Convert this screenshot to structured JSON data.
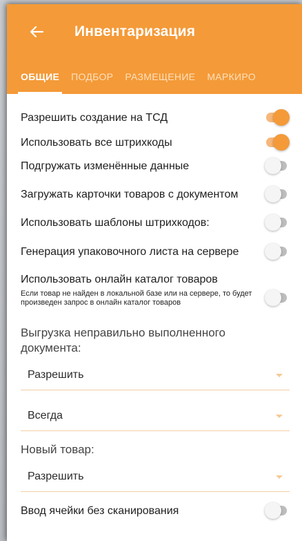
{
  "header": {
    "title": "Инвентаризация"
  },
  "tabs": [
    {
      "label": "ОБЩИЕ",
      "active": true
    },
    {
      "label": "ПОДБОР",
      "active": false
    },
    {
      "label": "РАЗМЕЩЕНИЕ",
      "active": false
    },
    {
      "label": "МАРКИРО",
      "active": false
    }
  ],
  "settings": [
    {
      "label": "Разрешить создание на ТСД",
      "enabled": true
    },
    {
      "label": "Использовать все штрихкоды",
      "enabled": true
    },
    {
      "label": "Подгружать изменённые данные",
      "enabled": false
    },
    {
      "label": "Загружать карточки товаров с документом",
      "enabled": false
    },
    {
      "label": "Использовать шаблоны штрихкодов:",
      "enabled": false
    },
    {
      "label": "Генерация упаковочного листа на сервере",
      "enabled": false
    },
    {
      "label": "Использовать онлайн каталог товаров",
      "note": "Если товар не найден в локальной базе или на сервере, то будет произведен запрос в онлайн каталог товаров",
      "enabled": false
    }
  ],
  "unload_section": {
    "label": "Выгрузка неправильно выполненного документа:",
    "select1": "Разрешить",
    "select2": "Всегда"
  },
  "new_item_section": {
    "label": "Новый товар:",
    "select": "Разрешить"
  },
  "last_setting": {
    "label": "Ввод ячейки без сканирования",
    "enabled": false
  },
  "colors": {
    "accent": "#f49a38",
    "tab_inactive": "#fde0bd",
    "toggle_off": "#bdbdbd"
  }
}
